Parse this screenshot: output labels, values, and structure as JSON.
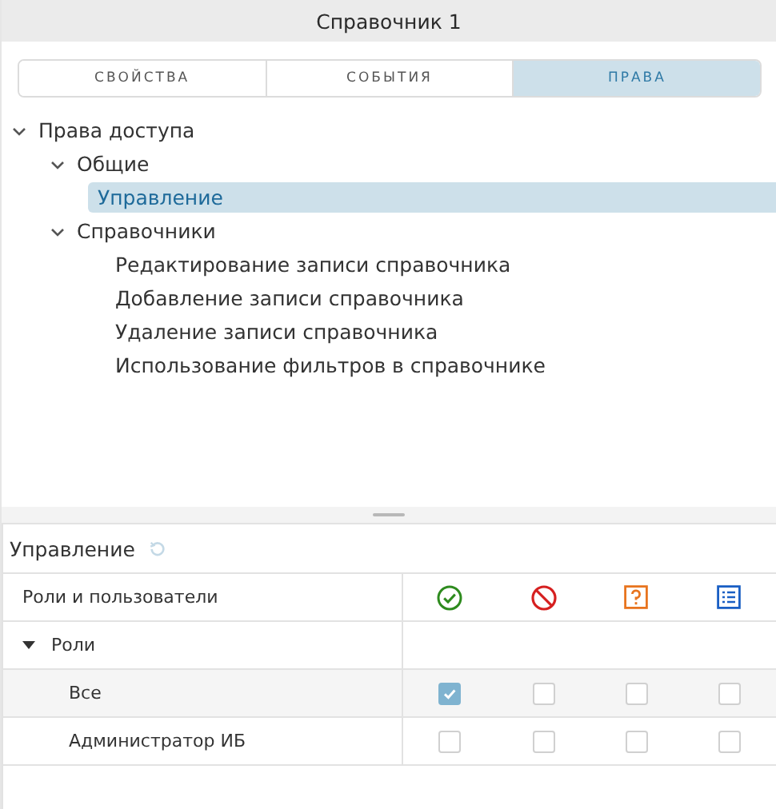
{
  "window": {
    "title": "Справочник 1"
  },
  "tabs": [
    {
      "label": "СВОЙСТВА",
      "selected": false
    },
    {
      "label": "СОБЫТИЯ",
      "selected": false
    },
    {
      "label": "ПРАВА",
      "selected": true
    }
  ],
  "tree": [
    {
      "label": "Права доступа",
      "expanded": true,
      "selected": false,
      "children": [
        {
          "label": "Общие",
          "expanded": true,
          "selected": false,
          "children": [
            {
              "label": "Управление",
              "selected": true
            }
          ]
        },
        {
          "label": "Справочники",
          "expanded": true,
          "selected": false,
          "children": [
            {
              "label": "Редактирование записи справочника",
              "selected": false
            },
            {
              "label": "Добавление записи справочника",
              "selected": false
            },
            {
              "label": "Удаление записи справочника",
              "selected": false
            },
            {
              "label": "Использование фильтров в справочнике",
              "selected": false
            }
          ]
        }
      ]
    }
  ],
  "permissions": {
    "title": "Управление",
    "columns": [
      {
        "label": "Роли и пользователи",
        "kind": "text"
      },
      {
        "kind": "allow"
      },
      {
        "kind": "deny"
      },
      {
        "kind": "ask"
      },
      {
        "kind": "list"
      }
    ],
    "groups": [
      {
        "label": "Роли",
        "expanded": true,
        "rows": [
          {
            "label": "Все",
            "selected": true,
            "checks": [
              true,
              false,
              false,
              false
            ]
          },
          {
            "label": "Администратор ИБ",
            "selected": false,
            "checks": [
              false,
              false,
              false,
              false
            ]
          }
        ]
      }
    ]
  }
}
